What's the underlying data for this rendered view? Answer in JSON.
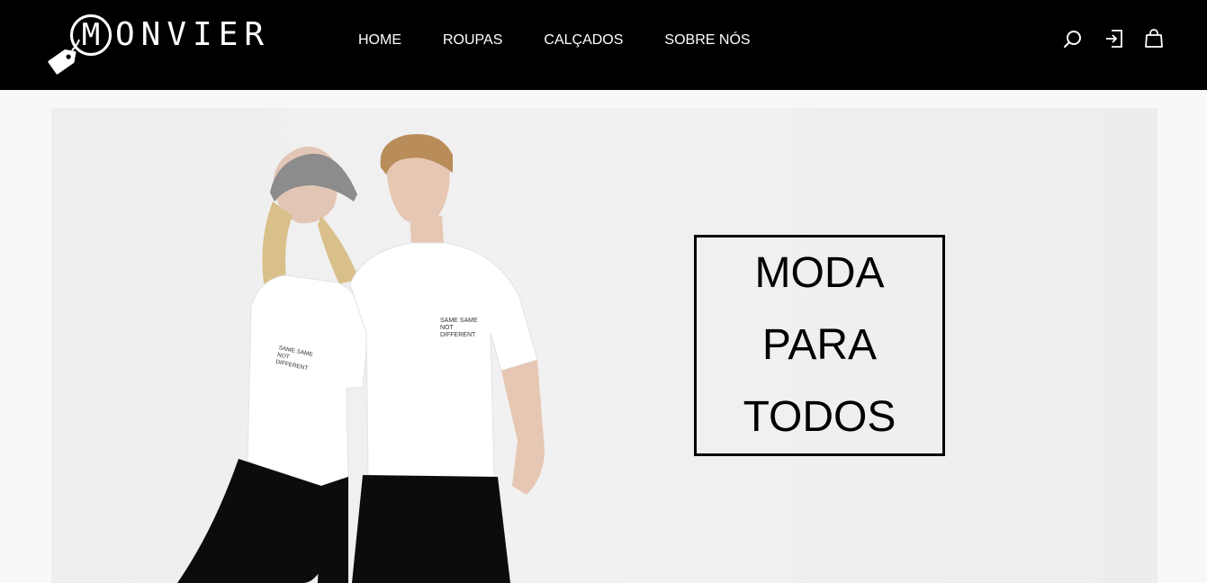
{
  "brand": {
    "logo_initial": "M",
    "logo_rest": "ONVIER"
  },
  "nav": {
    "items": [
      "HOME",
      "ROUPAS",
      "CALÇADOS",
      "SOBRE NÓS"
    ]
  },
  "tools": {
    "icons": [
      "search-icon",
      "login-icon",
      "shopping-bag-icon"
    ]
  },
  "hero": {
    "tagline": [
      "MODA",
      "PARA",
      "TODOS"
    ],
    "shirt_print": [
      "SAME SAME",
      "NOT",
      "DIFFERENT"
    ]
  },
  "colors": {
    "header_bg": "#000000",
    "page_bg": "#f8f8f8",
    "accent": "#ffffff"
  }
}
